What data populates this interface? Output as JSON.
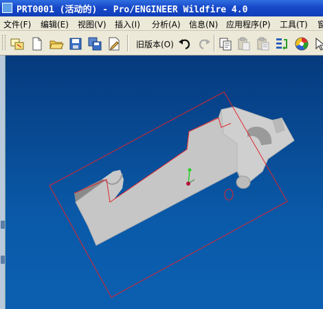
{
  "window": {
    "title": "PRT0001 (活动的) - Pro/ENGINEER Wildfire 4.0"
  },
  "menu": [
    {
      "label": "文件(F)"
    },
    {
      "label": "编辑(E)"
    },
    {
      "label": "视图(V)"
    },
    {
      "label": "插入(I)"
    },
    {
      "label": "分析(A)"
    },
    {
      "label": "信息(N)"
    },
    {
      "label": "应用程序(P)"
    },
    {
      "label": "工具(T)"
    },
    {
      "label": "窗"
    }
  ],
  "toolbar": {
    "previous_version_label": "旧版本(O)",
    "buttons": [
      {
        "icon": "window-icon"
      },
      {
        "icon": "new-file-icon"
      },
      {
        "icon": "open-folder-icon"
      },
      {
        "icon": "save-icon"
      },
      {
        "icon": "save-copy-icon"
      },
      {
        "icon": "edit-icon"
      },
      {
        "icon": "undo-icon"
      },
      {
        "icon": "redo-icon"
      },
      {
        "icon": "copy-icon"
      },
      {
        "icon": "paste-icon"
      },
      {
        "icon": "paste-special-icon"
      },
      {
        "icon": "regenerate-icon"
      },
      {
        "icon": "color-appearance-icon"
      },
      {
        "icon": "pointer-icon"
      }
    ]
  },
  "colors": {
    "title_bar": "#1748c8",
    "menu_background": "#ece9d8",
    "viewport_background": "#0a4c93",
    "part_face": "#c6c6c6",
    "part_shadow": "#8f8f8f",
    "selection_box": "#e0252b"
  }
}
